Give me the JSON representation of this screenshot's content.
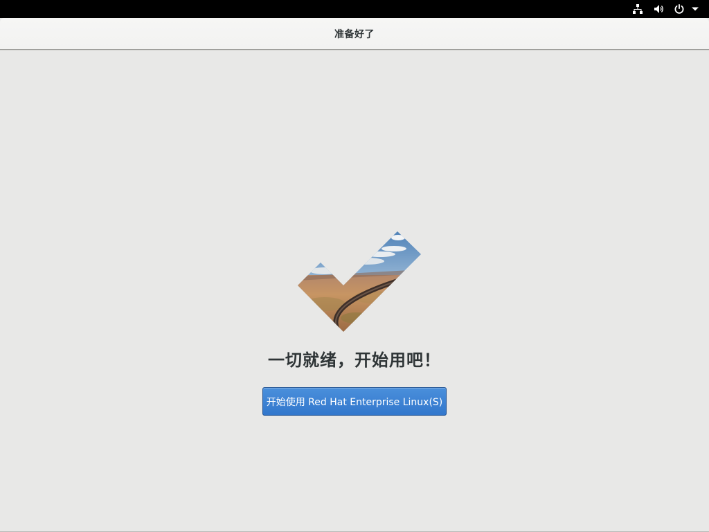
{
  "top_bar": {
    "icons": [
      "network-icon",
      "volume-icon",
      "power-icon",
      "dropdown-arrow-icon"
    ]
  },
  "window": {
    "title": "准备好了"
  },
  "main": {
    "graphic": "checkmark-landscape-image",
    "heading": "一切就绪，开始用吧！",
    "start_button_label": "开始使用 Red Hat Enterprise Linux(S)"
  },
  "colors": {
    "top_bar_bg": "#000000",
    "window_bg": "#e8e8e7",
    "header_bg": "#f4f4f3",
    "title_text": "#2e3436",
    "button_bg": "#3e83d4",
    "button_border": "#1b4f92",
    "button_text": "#ffffff"
  }
}
